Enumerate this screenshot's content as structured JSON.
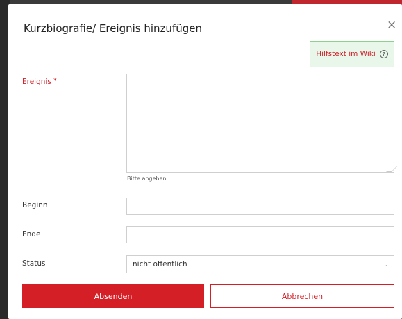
{
  "dialog": {
    "title": "Kurzbiografie/ Ereignis hinzufügen",
    "close_symbol": "×",
    "help_link_label": "Hilfstext im Wiki",
    "help_icon": "question-circle-icon"
  },
  "form": {
    "event": {
      "label": "Ereignis",
      "required_marker": "*",
      "value": "",
      "hint": "Bitte angeben"
    },
    "begin": {
      "label": "Beginn",
      "value": ""
    },
    "end": {
      "label": "Ende",
      "value": ""
    },
    "status": {
      "label": "Status",
      "selected": "nicht öffentlich"
    }
  },
  "actions": {
    "submit_label": "Absenden",
    "cancel_label": "Abbrechen"
  },
  "colors": {
    "accent": "#d41f26",
    "help_bg": "#e9f7ea",
    "help_border": "#8fcf8f"
  }
}
